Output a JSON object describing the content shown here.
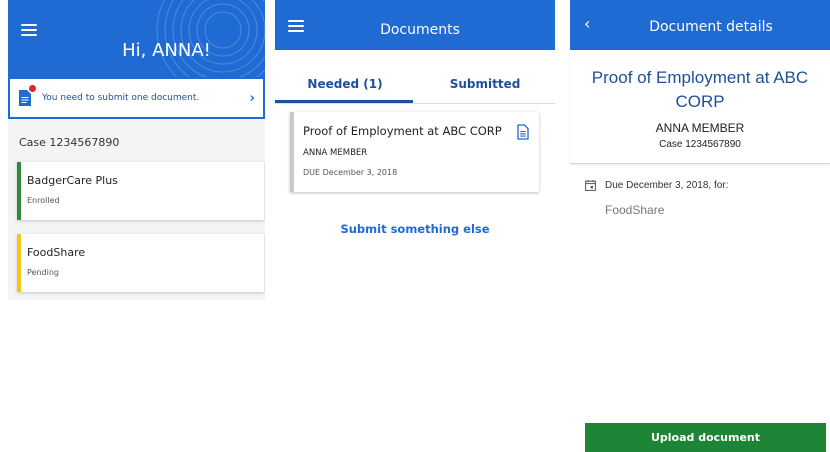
{
  "home": {
    "greeting": "Hi, ANNA!",
    "notice": "You need to submit one document.",
    "case_number": "Case 1234567890",
    "programs": [
      {
        "name": "BadgerCare Plus",
        "status": "Enrolled",
        "color": "#2e8b3d"
      },
      {
        "name": "FoodShare",
        "status": "Pending",
        "color": "#f2c916"
      }
    ]
  },
  "documents": {
    "title": "Documents",
    "tabs": [
      {
        "label": "Needed (1)",
        "selected": true
      },
      {
        "label": "Submitted",
        "selected": false
      }
    ],
    "items": [
      {
        "title": "Proof of Employment at ABC CORP",
        "member": "ANNA MEMBER",
        "due": "DUE December 3, 2018"
      }
    ],
    "submit_else": "Submit something else"
  },
  "details": {
    "title": "Document details",
    "doc_title": "Proof of Employment at ABC CORP",
    "member": "ANNA MEMBER",
    "case": "Case 1234567890",
    "due": "Due December 3, 2018, for:",
    "program": "FoodShare",
    "upload_label": "Upload document"
  },
  "colors": {
    "brand_blue": "#1f6ad3",
    "dark_blue": "#1f4f9a",
    "upload_green": "#1e8536",
    "alert_red": "#e0232c"
  }
}
